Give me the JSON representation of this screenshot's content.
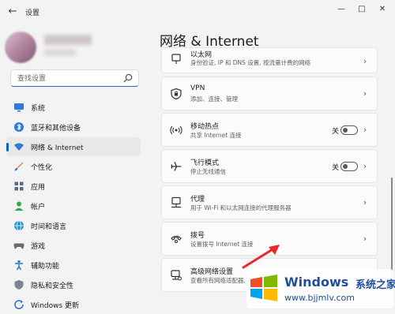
{
  "app": {
    "title": "设置"
  },
  "search": {
    "placeholder": "查找设置"
  },
  "sidebar": {
    "items": [
      {
        "label": "系统"
      },
      {
        "label": "蓝牙和其他设备"
      },
      {
        "label": "网络 & Internet"
      },
      {
        "label": "个性化"
      },
      {
        "label": "应用"
      },
      {
        "label": "帐户"
      },
      {
        "label": "时间和语言"
      },
      {
        "label": "游戏"
      },
      {
        "label": "辅助功能"
      },
      {
        "label": "隐私和安全性"
      },
      {
        "label": "Windows 更新"
      }
    ]
  },
  "main": {
    "title": "网络 & Internet",
    "cards": [
      {
        "title": "以太网",
        "subtitle": "身份验证, IP 和 DNS 设置, 按流量计费的网络"
      },
      {
        "title": "VPN",
        "subtitle": "添加、连接、管理"
      },
      {
        "title": "移动热点",
        "subtitle": "共享 Internet 连接",
        "toggle_label": "关"
      },
      {
        "title": "飞行模式",
        "subtitle": "停止无线通信",
        "toggle_label": "关"
      },
      {
        "title": "代理",
        "subtitle": "用于 Wi-Fi 和以太网连接的代理服务器"
      },
      {
        "title": "拨号",
        "subtitle": "设置拨号 Internet 连接"
      },
      {
        "title": "高级网络设置",
        "subtitle": "查看所有网络适配器, 网络重置"
      }
    ]
  },
  "watermark": {
    "brand": "Windows",
    "brand_suffix": "系统之家",
    "url": "www.bjjmlv.com"
  }
}
